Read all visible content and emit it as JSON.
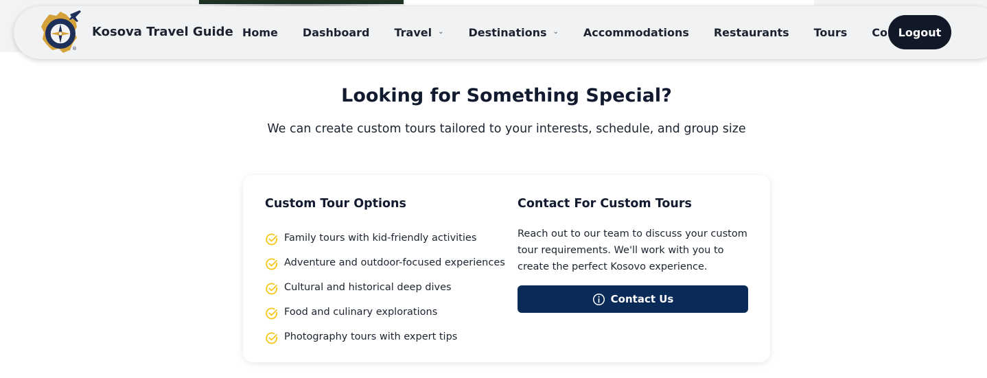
{
  "header": {
    "brand_name": "Kosova Travel Guide",
    "nav": [
      {
        "label": "Home",
        "has_dropdown": false
      },
      {
        "label": "Dashboard",
        "has_dropdown": false
      },
      {
        "label": "Travel",
        "has_dropdown": true
      },
      {
        "label": "Destinations",
        "has_dropdown": true
      },
      {
        "label": "Accommodations",
        "has_dropdown": false
      },
      {
        "label": "Restaurants",
        "has_dropdown": false
      },
      {
        "label": "Tours",
        "has_dropdown": false
      },
      {
        "label": "Contact",
        "has_dropdown": false
      }
    ],
    "logout_label": "Logout",
    "logo_icon": "compass-map-logo-icon"
  },
  "section": {
    "title": "Looking for Something Special?",
    "subtitle": "We can create custom tours tailored to your interests, schedule, and group size"
  },
  "card": {
    "options_title": "Custom Tour Options",
    "options": [
      "Family tours with kid-friendly activities",
      "Adventure and outdoor-focused experiences",
      "Cultural and historical deep dives",
      "Food and culinary explorations",
      "Photography tours with expert tips"
    ],
    "contact_title": "Contact For Custom Tours",
    "contact_text": "Reach out to our team to discuss your custom tour requirements. We'll work with you to create the perfect Kosovo experience.",
    "contact_button": "Contact Us"
  },
  "colors": {
    "nav_bg": "#f1f2f3",
    "logout_bg": "#111827",
    "primary_button": "#0a2a57",
    "check_accent": "#f5c518",
    "logo_gold": "#d4a23a",
    "logo_navy": "#1e2f5a"
  }
}
